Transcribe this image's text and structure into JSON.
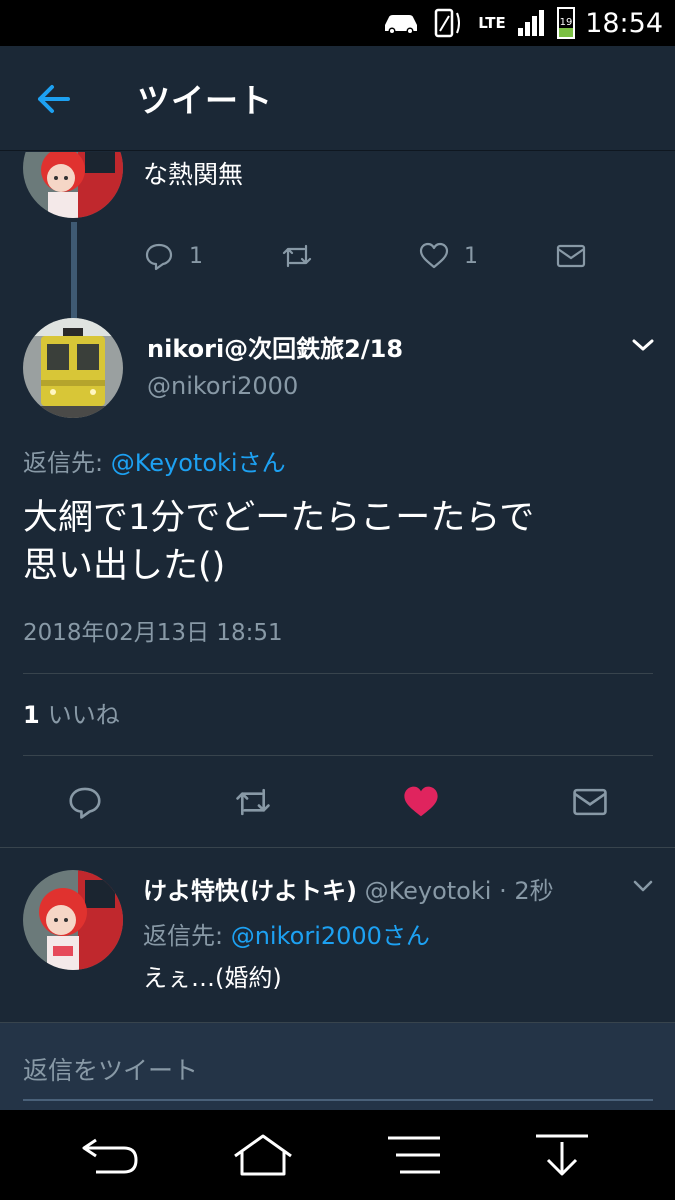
{
  "status_bar": {
    "time": "18:54",
    "network": "LTE",
    "battery_level": "19",
    "icons": [
      "car-icon",
      "vibrate-icon",
      "lte-icon",
      "signal-icon",
      "battery-icon"
    ]
  },
  "app_bar": {
    "title": "ツイート",
    "back_icon": "arrow-left-icon"
  },
  "parent_tweet": {
    "text": "な熱関無",
    "reply_count": "1",
    "like_count": "1"
  },
  "main_tweet": {
    "author_name": "nikori@次回鉄旅2/18",
    "author_handle": "@nikori2000",
    "reply_to_label": "返信先: ",
    "reply_to_user": "@Keyotokiさん",
    "text_line1": "大網で1分でどーたらこーたらで",
    "text_line2": "思い出した()",
    "timestamp": "2018年02月13日 18:51",
    "likes_count": "1",
    "likes_label": "いいね"
  },
  "reply_tweet": {
    "author_name": "けよ特快(けよトキ)",
    "author_handle_time": "@Keyotoki · 2秒",
    "reply_to_label": "返信先: ",
    "reply_to_user": "@nikori2000さん",
    "text": "えぇ…(婚約)"
  },
  "compose": {
    "placeholder": "返信をツイート"
  },
  "colors": {
    "background": "#1b2836",
    "accent": "#1da1f2",
    "muted": "#8899a6",
    "like": "#e0245e"
  }
}
